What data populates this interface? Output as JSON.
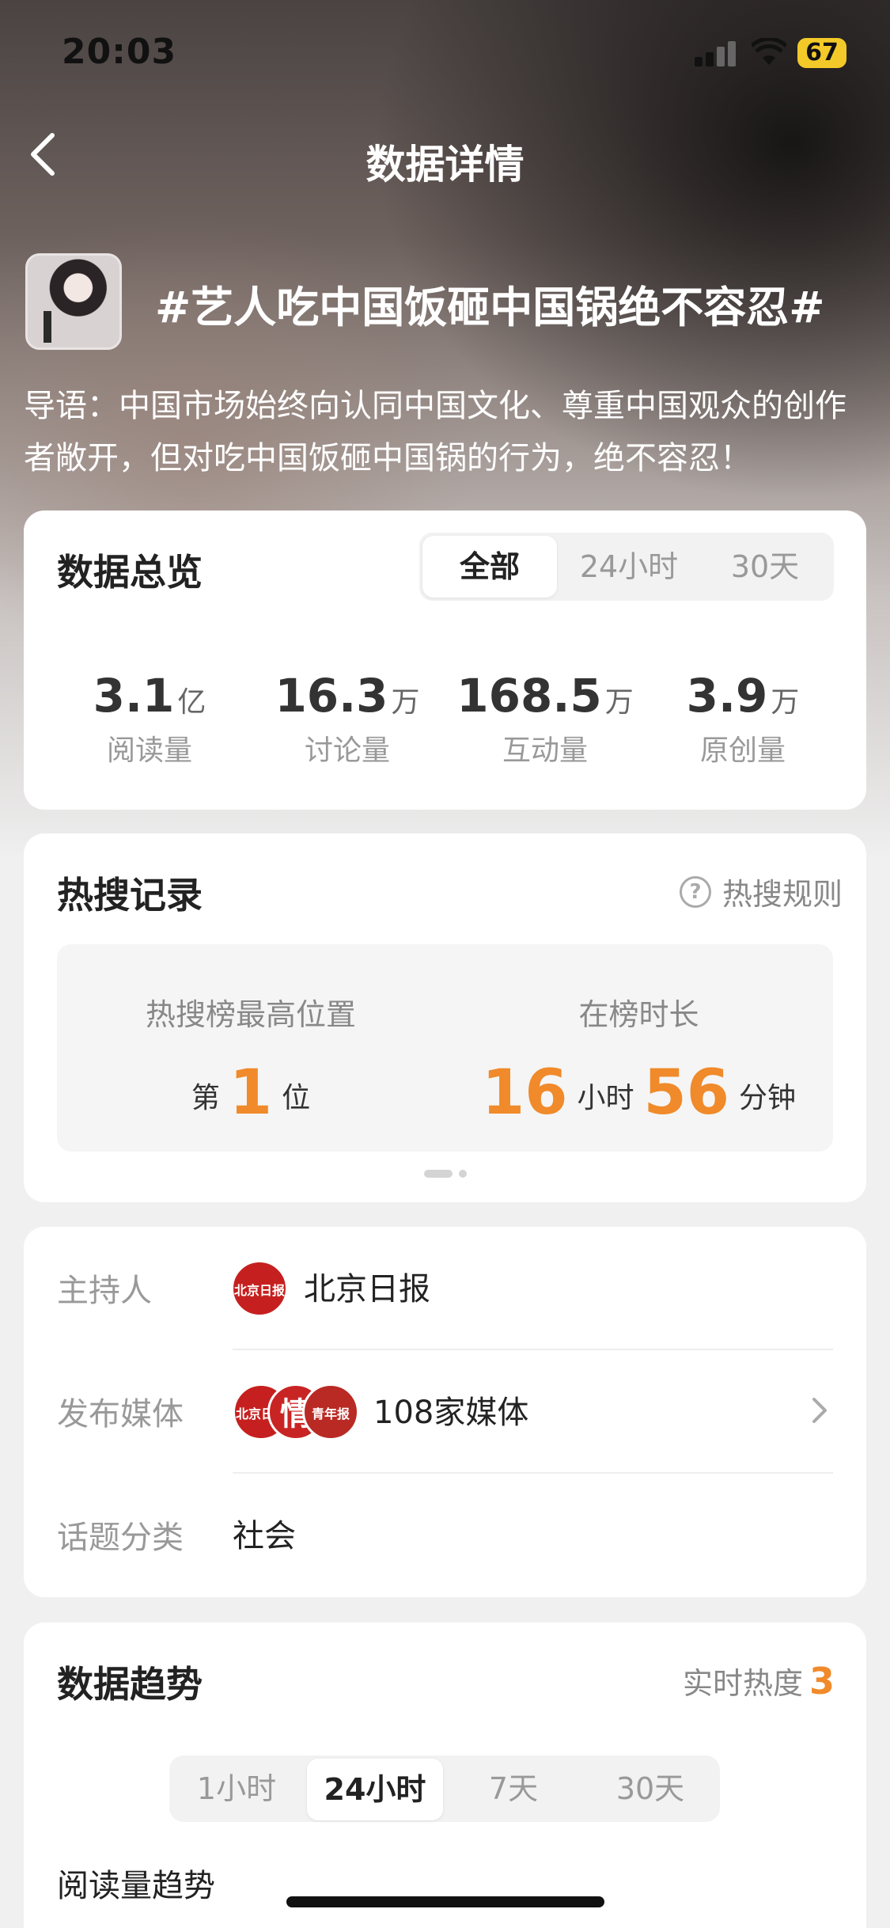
{
  "status_bar": {
    "time": "20:03",
    "battery": "67"
  },
  "nav": {
    "title": "数据详情"
  },
  "topic": {
    "title": "#艺人吃中国饭砸中国锅绝不容忍#",
    "intro": "导语：中国市场始终向认同中国文化、尊重中国观众的创作者敞开，但对吃中国饭砸中国锅的行为，绝不容忍！"
  },
  "overview": {
    "title": "数据总览",
    "tabs": [
      "全部",
      "24小时",
      "30天"
    ],
    "active_tab": "全部",
    "stats": [
      {
        "value": "3.1",
        "unit": "亿",
        "label": "阅读量"
      },
      {
        "value": "16.3",
        "unit": "万",
        "label": "讨论量"
      },
      {
        "value": "168.5",
        "unit": "万",
        "label": "互动量"
      },
      {
        "value": "3.9",
        "unit": "万",
        "label": "原创量"
      }
    ]
  },
  "hot_search": {
    "title": "热搜记录",
    "rule_link": "热搜规则",
    "rule_icon": "?",
    "best_rank_label": "热搜榜最高位置",
    "rank_prefix": "第",
    "rank_value": "1",
    "rank_suffix": "位",
    "duration_label": "在榜时长",
    "hours": "16",
    "hours_unit": "小时",
    "minutes": "56",
    "minutes_unit": "分钟"
  },
  "info": {
    "host_label": "主持人",
    "host_name": "北京日报",
    "host_logo_text": "北京日报",
    "media_label": "发布媒体",
    "media_count": "108家媒体",
    "media_logos": [
      "北京日报",
      "情",
      "青年报"
    ],
    "category_label": "话题分类",
    "category": "社会"
  },
  "trend": {
    "title": "数据趋势",
    "heat_label": "实时热度",
    "heat_value": "3",
    "tabs": [
      "1小时",
      "24小时",
      "7天",
      "30天"
    ],
    "active_tab": "24小时",
    "subtitle": "阅读量趋势"
  },
  "colors": {
    "accent": "#f08a2a",
    "logo_red": "#c5201f"
  },
  "icons": {
    "back": "chevron-left-icon",
    "more": "chevron-right-icon",
    "help": "question-circle-icon"
  }
}
